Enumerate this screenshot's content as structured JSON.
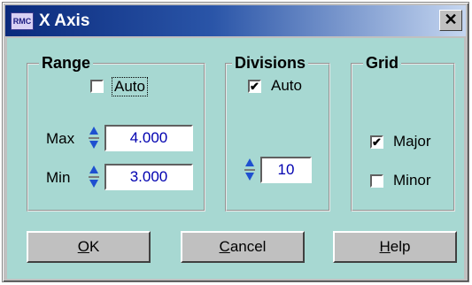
{
  "window": {
    "title": "X Axis",
    "app_icon_text": "RMC",
    "close_label": "✕"
  },
  "range": {
    "title": "Range",
    "auto_label": "Auto",
    "auto_checked": false,
    "max_label": "Max",
    "max_value": "4.000",
    "min_label": "Min",
    "min_value": "3.000"
  },
  "divisions": {
    "title": "Divisions",
    "auto_label": "Auto",
    "auto_checked": true,
    "value": "10"
  },
  "grid": {
    "title": "Grid",
    "major_label": "Major",
    "major_checked": true,
    "minor_label": "Minor",
    "minor_checked": false
  },
  "buttons": {
    "ok_mnemonic": "O",
    "ok_rest": "K",
    "cancel_mnemonic": "C",
    "cancel_rest": "ancel",
    "help_mnemonic": "H",
    "help_rest": "elp"
  },
  "colors": {
    "client_bg": "#a7d8d2",
    "title_gradient_start": "#0a2a7c",
    "title_gradient_end": "#c5d6f0",
    "value_text": "#0000b0",
    "spinner_arrow": "#1e50d0"
  }
}
